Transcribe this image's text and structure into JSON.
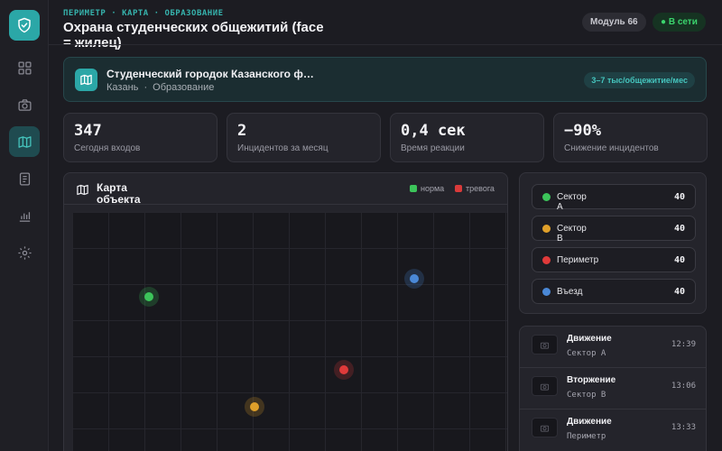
{
  "breadcrumb": "ПЕРИМЕТР · КАРТА · ОБРАЗОВАНИЕ",
  "page_title": "Охрана студенческих общежитий (face = жилец)",
  "header": {
    "module_badge": "Модуль 66",
    "online_badge": "● В сети"
  },
  "sidebar": {
    "items": [
      {
        "icon": "dashboard-icon",
        "active": false
      },
      {
        "icon": "camera-icon",
        "active": false
      },
      {
        "icon": "map-icon",
        "active": true
      },
      {
        "icon": "document-icon",
        "active": false
      },
      {
        "icon": "bar-chart-icon",
        "active": false
      },
      {
        "icon": "gear-icon",
        "active": false
      }
    ]
  },
  "banner": {
    "title": "Студенческий городок Казанского ф…",
    "city": "Казань",
    "separator": "·",
    "category": "Образование",
    "price": "3–7 тыс/общежитие/мес"
  },
  "stats": [
    {
      "value": "347",
      "label": "Сегодня входов"
    },
    {
      "value": "2",
      "label": "Инцидентов за месяц"
    },
    {
      "value": "0,4 сек",
      "label": "Время реакции"
    },
    {
      "value": "−90%",
      "label": "Снижение инцидентов"
    }
  ],
  "map": {
    "title": "Карта объекта",
    "legend": [
      {
        "label": "норма",
        "color": "#3cc45a"
      },
      {
        "label": "тревога",
        "color": "#d93a3a"
      }
    ],
    "markers": [
      {
        "name": "marker-green",
        "color": "#3cc45a"
      },
      {
        "name": "marker-blue",
        "color": "#4a88d6"
      },
      {
        "name": "marker-red",
        "color": "#e03a3a"
      },
      {
        "name": "marker-orange",
        "color": "#e0a02a"
      }
    ]
  },
  "sectors": [
    {
      "name": "Сектор А",
      "count": "40",
      "color": "#3cc45a"
    },
    {
      "name": "Сектор В",
      "count": "40",
      "color": "#e0a02a"
    },
    {
      "name": "Периметр",
      "count": "40",
      "color": "#e03a3a"
    },
    {
      "name": "Въезд",
      "count": "40",
      "color": "#4a88d6"
    }
  ],
  "events": [
    {
      "type": "Движение",
      "location": "Сектор А",
      "time": "12:39"
    },
    {
      "type": "Вторжение",
      "location": "Сектор В",
      "time": "13:06"
    },
    {
      "type": "Движение",
      "location": "Периметр",
      "time": "13:33"
    }
  ],
  "colors": {
    "accent": "#2ba7a7",
    "online": "#3bd46d",
    "alert": "#e03a3a"
  }
}
